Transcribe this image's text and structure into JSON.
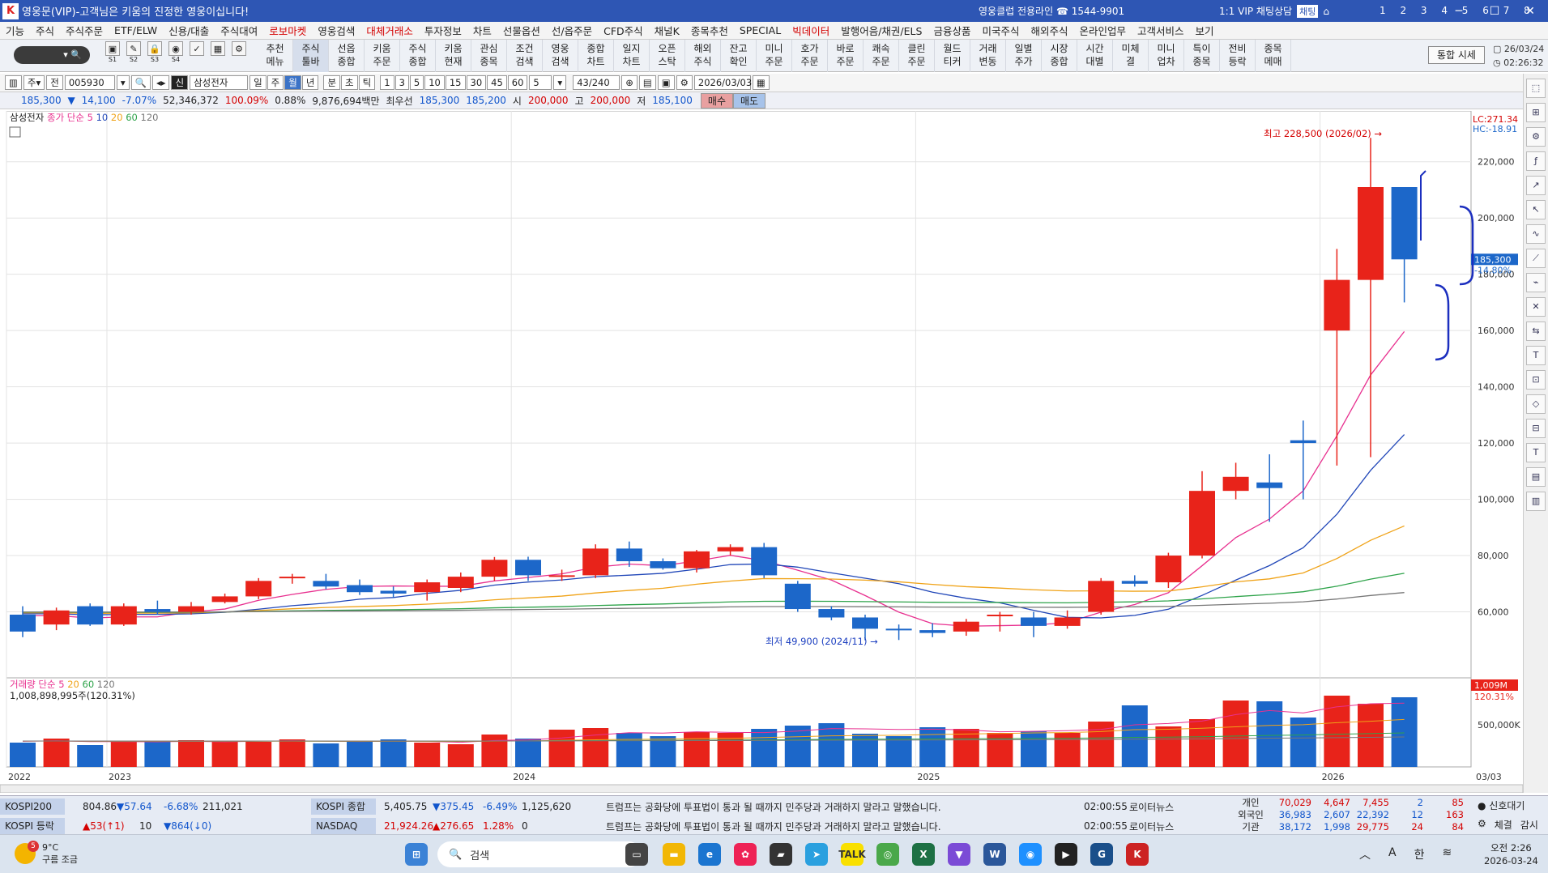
{
  "window": {
    "title": "영웅문(VIP)-고객님은 키움의 진정한 영웅이십니다!",
    "center_text": "영웅클럽 전용라인 ☎ 1544-9901",
    "chat_label": "1:1 VIP 채팅상담",
    "chat_badge": "채팅",
    "screen_nums": "1 2 3 4 5 6 7 8"
  },
  "menu": [
    "기능",
    "주식",
    "주식주문",
    "ETF/ELW",
    "신용/대출",
    "주식대여",
    "로보마켓",
    "영웅검색",
    "대체거래소",
    "투자정보",
    "차트",
    "선물옵션",
    "선/옵주문",
    "CFD주식",
    "채널K",
    "종목추천",
    "SPECIAL",
    "빅데이터",
    "발행어음/채권/ELS",
    "금융상품",
    "미국주식",
    "해외주식",
    "온라인업무",
    "고객서비스",
    "보기"
  ],
  "menu_red": [
    "로보마켓",
    "대체거래소",
    "빅데이터"
  ],
  "toolbar": {
    "quick": [
      "S1",
      "S2",
      "S3",
      "S4"
    ],
    "buttons": [
      "추천\n메뉴",
      "주식\n툴바",
      "선옵\n종합",
      "키움\n주문",
      "주식\n종합",
      "키움\n현재",
      "관심\n종목",
      "조건\n검색",
      "영웅\n검색",
      "종합\n차트",
      "일지\n차트",
      "오픈\n스탁",
      "해외\n주식",
      "잔고\n확인",
      "미니\n주문",
      "호가\n주문",
      "바로\n주문",
      "쾌속\n주문",
      "클린\n주문",
      "월드\n티커",
      "거래\n변동",
      "일별\n주가",
      "시장\n종합",
      "시간\n대별",
      "미체\n결",
      "미니\n업차",
      "특이\n종목",
      "전비\n등락",
      "종목\n메매"
    ],
    "integrated_quote": "통합 시세",
    "date": "26/03/24",
    "time": "02:26:32"
  },
  "controls": {
    "code": "005930",
    "stock_name": "삼성전자",
    "badge": "신",
    "periods": [
      "일",
      "주",
      "월",
      "년"
    ],
    "selected_period": "월",
    "minute_opts": [
      "분",
      "초",
      "틱"
    ],
    "intervals": [
      "1",
      "3",
      "5",
      "10",
      "15",
      "30",
      "45",
      "60"
    ],
    "count_val": "5",
    "bars": "43",
    "bars_total": "/240",
    "date": "2026/03/03"
  },
  "quote": {
    "price": "185,300",
    "change": "14,100",
    "pct": "-7.07%",
    "volume": "52,346,372",
    "vol_ratio": "100.09%",
    "turnover": "0.88%",
    "amount": "9,876,694백만",
    "best_label": "최우선",
    "best_ask": "185,300",
    "best_bid": "185,200",
    "open_label": "시",
    "open": "200,000",
    "high_label": "고",
    "high": "200,000",
    "low_label": "저",
    "low": "185,100",
    "buy": "매수",
    "sell": "매도"
  },
  "chart": {
    "name_tag": "삼성전자",
    "ma_label": "종가 단순",
    "ma_periods": [
      "5",
      "10",
      "20",
      "60",
      "120"
    ],
    "high_note": "최고 228,500 (2026/02) →",
    "low_note": "최저 49,900 (2024/11) →",
    "lc": "LC:271.34",
    "hc": "HC:-18.91",
    "price_axis": [
      "220,000",
      "200,000",
      "180,000",
      "160,000",
      "140,000",
      "120,000",
      "100,000",
      "80,000",
      "60,000"
    ],
    "cur_price_tag": "185,300",
    "cur_pct_tag": "-14.80%",
    "vol_label": "거래량 단순",
    "vol_total": "1,008,898,995주(120.31%)",
    "vol_tag": "1,009M",
    "vol_pct_tag": "120.31%",
    "vol_axis": "500,000K",
    "years": [
      "2022",
      "2023",
      "2024",
      "2025",
      "2026"
    ],
    "date_tag": "03/03",
    "colors": {
      "up": "#e8231a",
      "down": "#1c67c9",
      "ma5": "#e8308f",
      "ma10": "#2147b8",
      "ma20": "#f0a318",
      "ma60": "#2ea34a",
      "ma120": "#777777"
    }
  },
  "chart_data": {
    "type": "candlestick",
    "title": "삼성전자",
    "x": [
      "2022/10",
      "2022/11",
      "2022/12",
      "2023/01",
      "2023/02",
      "2023/03",
      "2023/04",
      "2023/05",
      "2023/06",
      "2023/07",
      "2023/08",
      "2023/09",
      "2023/10",
      "2023/11",
      "2023/12",
      "2024/01",
      "2024/02",
      "2024/03",
      "2024/04",
      "2024/05",
      "2024/06",
      "2024/07",
      "2024/08",
      "2024/09",
      "2024/10",
      "2024/11",
      "2024/12",
      "2025/01",
      "2025/02",
      "2025/03",
      "2025/04",
      "2025/05",
      "2025/06",
      "2025/07",
      "2025/08",
      "2025/09",
      "2025/10",
      "2025/11",
      "2025/12",
      "2026/01",
      "2026/02",
      "2026/03"
    ],
    "open": [
      59000,
      55500,
      62000,
      55500,
      61000,
      60000,
      63500,
      65500,
      72000,
      71000,
      69500,
      67500,
      67000,
      68500,
      72500,
      78500,
      73000,
      73000,
      82500,
      78000,
      75500,
      81500,
      83000,
      70000,
      61000,
      58000,
      54000,
      53500,
      53000,
      58500,
      58000,
      55000,
      60000,
      71000,
      70500,
      80000,
      103000,
      106000,
      121000,
      160000,
      178000,
      211000
    ],
    "close": [
      53000,
      60500,
      55500,
      62000,
      60000,
      62000,
      65500,
      71000,
      72500,
      69000,
      67000,
      66500,
      70500,
      72500,
      78500,
      73000,
      73000,
      82500,
      78000,
      75500,
      81500,
      83000,
      73000,
      61000,
      58000,
      54000,
      53500,
      52500,
      56500,
      59000,
      55000,
      58000,
      71000,
      70000,
      80000,
      103000,
      108000,
      104000,
      120000,
      178000,
      211000,
      185300
    ],
    "high": [
      62000,
      61500,
      63000,
      63000,
      64000,
      63500,
      66500,
      72000,
      73500,
      73500,
      71500,
      69000,
      71500,
      74000,
      79500,
      79600,
      75000,
      84000,
      85000,
      79000,
      82000,
      84000,
      84500,
      71000,
      62000,
      59000,
      55500,
      56000,
      57500,
      60000,
      60000,
      60500,
      72000,
      73000,
      81000,
      110000,
      113000,
      116000,
      128000,
      189000,
      228500,
      203000
    ],
    "low": [
      51000,
      53500,
      55000,
      55000,
      59000,
      59000,
      63000,
      64500,
      70000,
      68000,
      66000,
      65000,
      64000,
      67000,
      71000,
      71000,
      71000,
      72000,
      76000,
      75000,
      74000,
      80000,
      72000,
      60000,
      57000,
      49900,
      50000,
      51000,
      51500,
      53000,
      51000,
      54000,
      59000,
      69000,
      68500,
      79000,
      100000,
      92000,
      100000,
      112000,
      115000,
      170000
    ],
    "volume": [
      300,
      350,
      270,
      320,
      310,
      330,
      320,
      310,
      340,
      290,
      310,
      340,
      300,
      280,
      400,
      350,
      460,
      480,
      420,
      380,
      430,
      420,
      470,
      510,
      540,
      410,
      380,
      490,
      470,
      420,
      440,
      420,
      560,
      760,
      500,
      590,
      820,
      810,
      610,
      880,
      780,
      860
    ],
    "ylim": [
      40000,
      230000
    ]
  },
  "status": {
    "row1": {
      "idx1": "KOSPI200",
      "v1": "804.86",
      "c1": "▼57.64",
      "p1": "-6.68%",
      "q1": "211,021",
      "idx2": "KOSPI 종합",
      "v2": "5,405.75",
      "c2": "▼375.45",
      "p2": "-6.49%",
      "q2": "1,125,620",
      "news": "트럼프는 공화당에 투표법이 통과 될 때까지 민주당과 거래하지 말라고 말했습니다.",
      "time": "02:00:55",
      "src": "로이터뉴스"
    },
    "row2": {
      "idx1": "KOSPI 등락",
      "v1": "▲53(↑1)",
      "c1": "10",
      "p1": "▼864(↓0)",
      "idx2": "NASDAQ",
      "v2": "21,924.26",
      "c2": "▲276.65",
      "p2": "1.28%",
      "q2": "0",
      "news": "트럼프는 공화당에 투표법이 통과 될 때까지 민주당과 거래하지 말라고 말했습니다.",
      "time": "02:00:55",
      "src": "로이터뉴스"
    },
    "investors": {
      "l1": "개인",
      "l2": "외국인",
      "l3": "기관",
      "a1": "70,029",
      "a2": "36,983",
      "a3": "38,172",
      "b1": "4,647",
      "b2": "2,607",
      "b3": "1,998",
      "c1": "7,455",
      "c2": "22,392",
      "c3": "29,775",
      "d1": "2",
      "d2": "12",
      "d3": "24",
      "e1": "85",
      "e2": "163",
      "e3": "84"
    },
    "signal": "신호대기",
    "side": [
      "체결",
      "감시"
    ]
  },
  "taskbar": {
    "temp": "9°C",
    "weather": "구름 조금",
    "weather_badge": "5",
    "search": "검색",
    "time": "오전 2:26",
    "date": "2026-03-24",
    "lang1": "A",
    "lang2": "한"
  }
}
